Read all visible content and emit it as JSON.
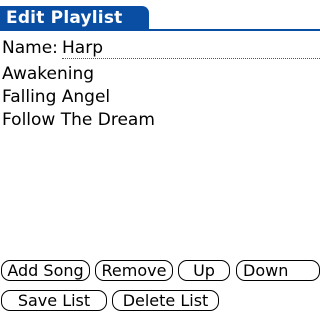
{
  "header": {
    "title": "Edit Playlist"
  },
  "form": {
    "name_label": "Name:",
    "name_value": "Harp"
  },
  "songs": [
    "Awakening",
    "Falling Angel",
    "Follow The Dream"
  ],
  "buttons": {
    "add_song": "Add Song",
    "remove": "Remove",
    "up": "Up",
    "down": "Down",
    "save_list": "Save List",
    "delete_list": "Delete List"
  },
  "colors": {
    "title_bar": "#0a4ea3"
  }
}
